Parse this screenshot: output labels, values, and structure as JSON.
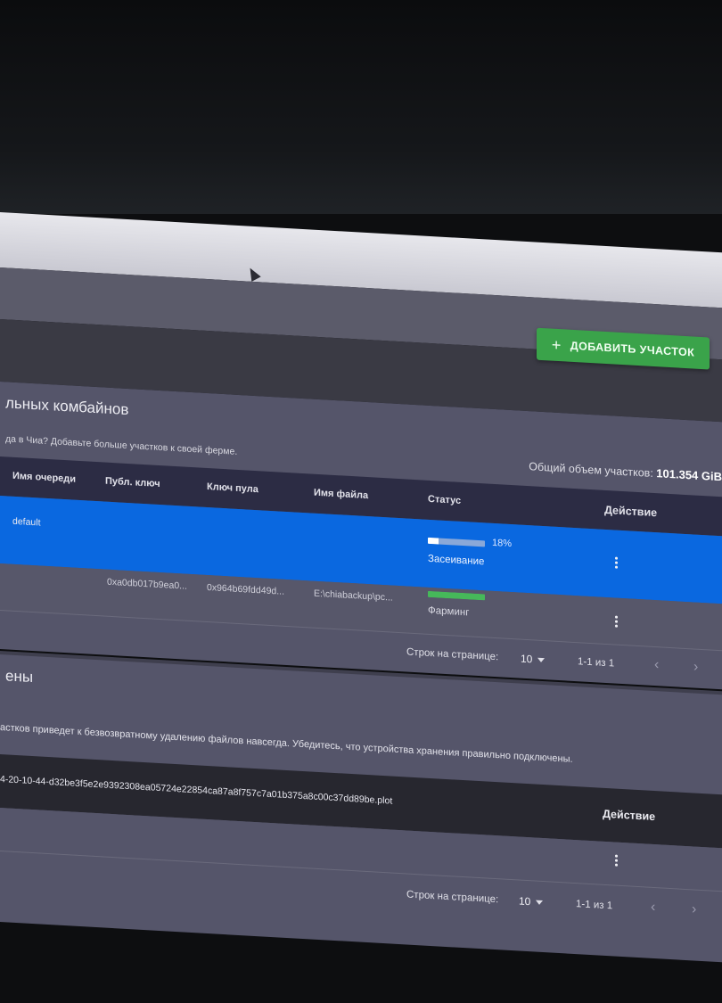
{
  "toolbar": {
    "add_plot_label": "ДОБАВИТЬ УЧАСТОК",
    "add_icon": "plus-icon"
  },
  "plotting": {
    "title": "льных комбайнов",
    "subtitle": "да в Чиа? Добавьте больше участков к своей ферме.",
    "total_label": "Общий объем участков:",
    "total_value": "101.354 GiB",
    "columns": {
      "queue": "Имя очереди",
      "pubkey": "Публ. ключ",
      "pool_key": "Ключ пула",
      "filename": "Имя файла",
      "status": "Статус",
      "action": "Действие"
    },
    "rows": [
      {
        "queue": "default",
        "pubkey": "",
        "pool_key": "",
        "filename": "",
        "progress": 0.18,
        "progress_text": "18%",
        "status": "Засеивание"
      },
      {
        "queue": "",
        "pubkey": "0xa0db017b9ea0...",
        "pool_key": "0x964b69fdd49d...",
        "filename": "E:\\chiabackup\\pc...",
        "progress": 1.0,
        "progress_text": "",
        "status": "Фарминг"
      }
    ],
    "pager": {
      "rows_label": "Строк на странице:",
      "rows_value": "10",
      "range": "1-1 из 1"
    }
  },
  "plots": {
    "title": "ены",
    "warning": "астков приведет к безвозвратному удалению файлов навсегда. Убедитесь, что устройства хранения правильно подключены.",
    "filename": "4-20-10-44-d32be3f5e2e9392308ea05724e22854ca87a8f757c7a01b375a8c00c37dd89be.plot",
    "action_header": "Действие",
    "pager": {
      "rows_label": "Строк на странице:",
      "rows_value": "10",
      "range": "1-1 из 1"
    }
  },
  "colors": {
    "accent_green": "#3aa34a",
    "selected_row": "#0a68e0",
    "header_dark": "#2c2c44"
  }
}
